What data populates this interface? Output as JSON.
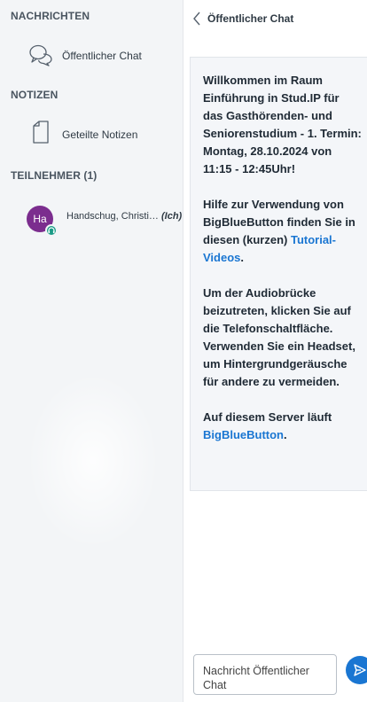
{
  "sidebar": {
    "messages_title": "NACHRICHTEN",
    "public_chat_label": "Öffentlicher Chat",
    "notes_title": "NOTIZEN",
    "shared_notes_label": "Geteilte Notizen",
    "participants_title": "TEILNEHMER (1)",
    "user": {
      "initials": "Ha",
      "name": "Handschug, Christi…",
      "you_tag": "(Ich)"
    }
  },
  "chat": {
    "title": "Öffentlicher Chat",
    "welcome": {
      "p1": "Willkommen im Raum Einführung in Stud.IP für das Gasthörenden- und Seniorenstudium - 1. Termin: Montag, 28.10.2024 von 11:15 - 12:45Uhr!",
      "p2_text": "Hilfe zur Verwendung von BigBlueButton finden Sie in diesen (kurzen) ",
      "p2_link": "Tutorial-Videos",
      "p2_end": ".",
      "p3": "Um der Audiobrücke beizutreten, klicken Sie auf die Telefonschaltfläche. Verwenden Sie ein Headset, um Hintergrundgeräusche für andere zu vermeiden.",
      "p4_text": "Auf diesem Server läuft ",
      "p4_link": "BigBlueButton",
      "p4_end": "."
    },
    "input_placeholder": "Nachricht Öffentlicher Chat"
  },
  "colors": {
    "accent": "#1a76d2",
    "avatar": "#7b2d8e",
    "audio_badge": "#1a9b86"
  },
  "icons": [
    "chat-bubbles-icon",
    "note-icon",
    "headset-icon",
    "chevron-left-icon",
    "send-icon"
  ]
}
